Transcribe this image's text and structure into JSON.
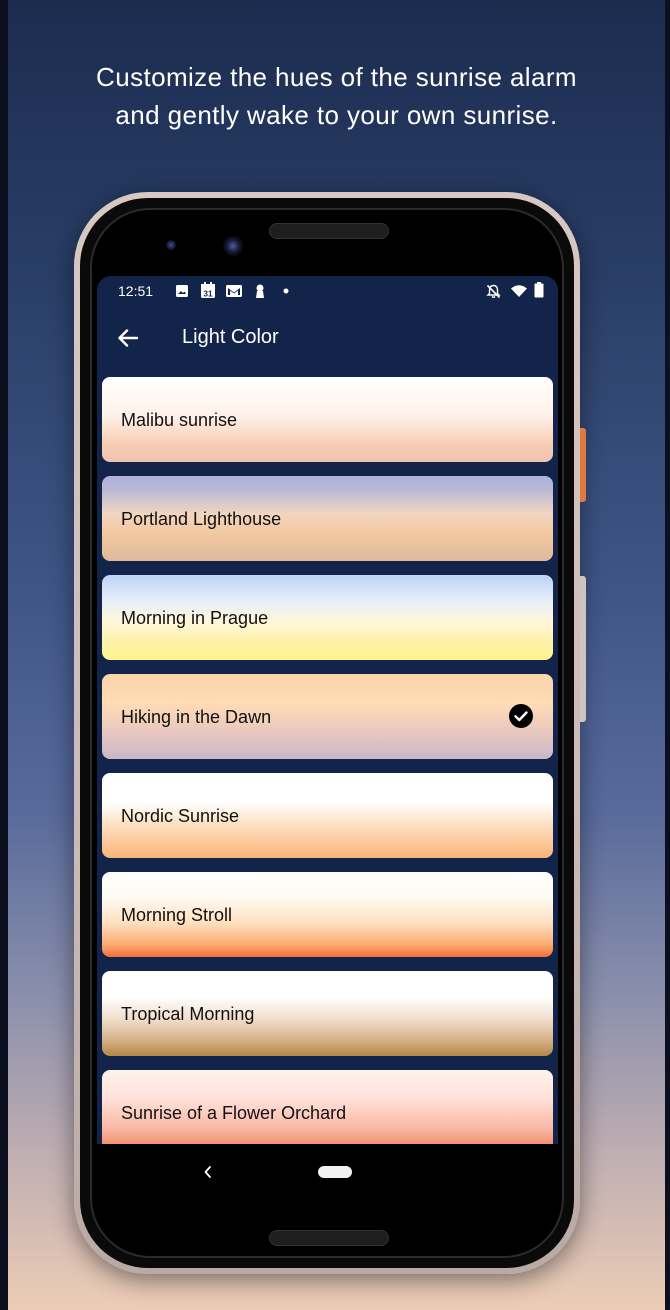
{
  "headline": {
    "line1": "Customize the hues of the sunrise alarm",
    "line2": "and gently wake to your own sunrise."
  },
  "status_bar": {
    "time": "12:51",
    "icons": [
      "image-icon",
      "calendar-icon",
      "gmail-icon",
      "lock-icon",
      "dot-icon",
      "bell-off-icon",
      "wifi-icon",
      "battery-icon"
    ],
    "calendar_day": "31"
  },
  "app_bar": {
    "back_icon": "arrow-back-icon",
    "title": "Light Color"
  },
  "light_colors": [
    {
      "label": "Malibu sunrise",
      "selected": false
    },
    {
      "label": "Portland Lighthouse",
      "selected": false
    },
    {
      "label": "Morning in Prague",
      "selected": false
    },
    {
      "label": "Hiking in the Dawn",
      "selected": true
    },
    {
      "label": "Nordic Sunrise",
      "selected": false
    },
    {
      "label": "Morning Stroll",
      "selected": false
    },
    {
      "label": "Tropical Morning",
      "selected": false
    },
    {
      "label": "Sunrise of a Flower Orchard",
      "selected": false
    }
  ],
  "nav_bar": {
    "back_icon": "nav-back-chevron-icon",
    "home_icon": "nav-home-pill-icon"
  },
  "colors": {
    "screen_background": "#13244a",
    "check_color": "#000000"
  }
}
